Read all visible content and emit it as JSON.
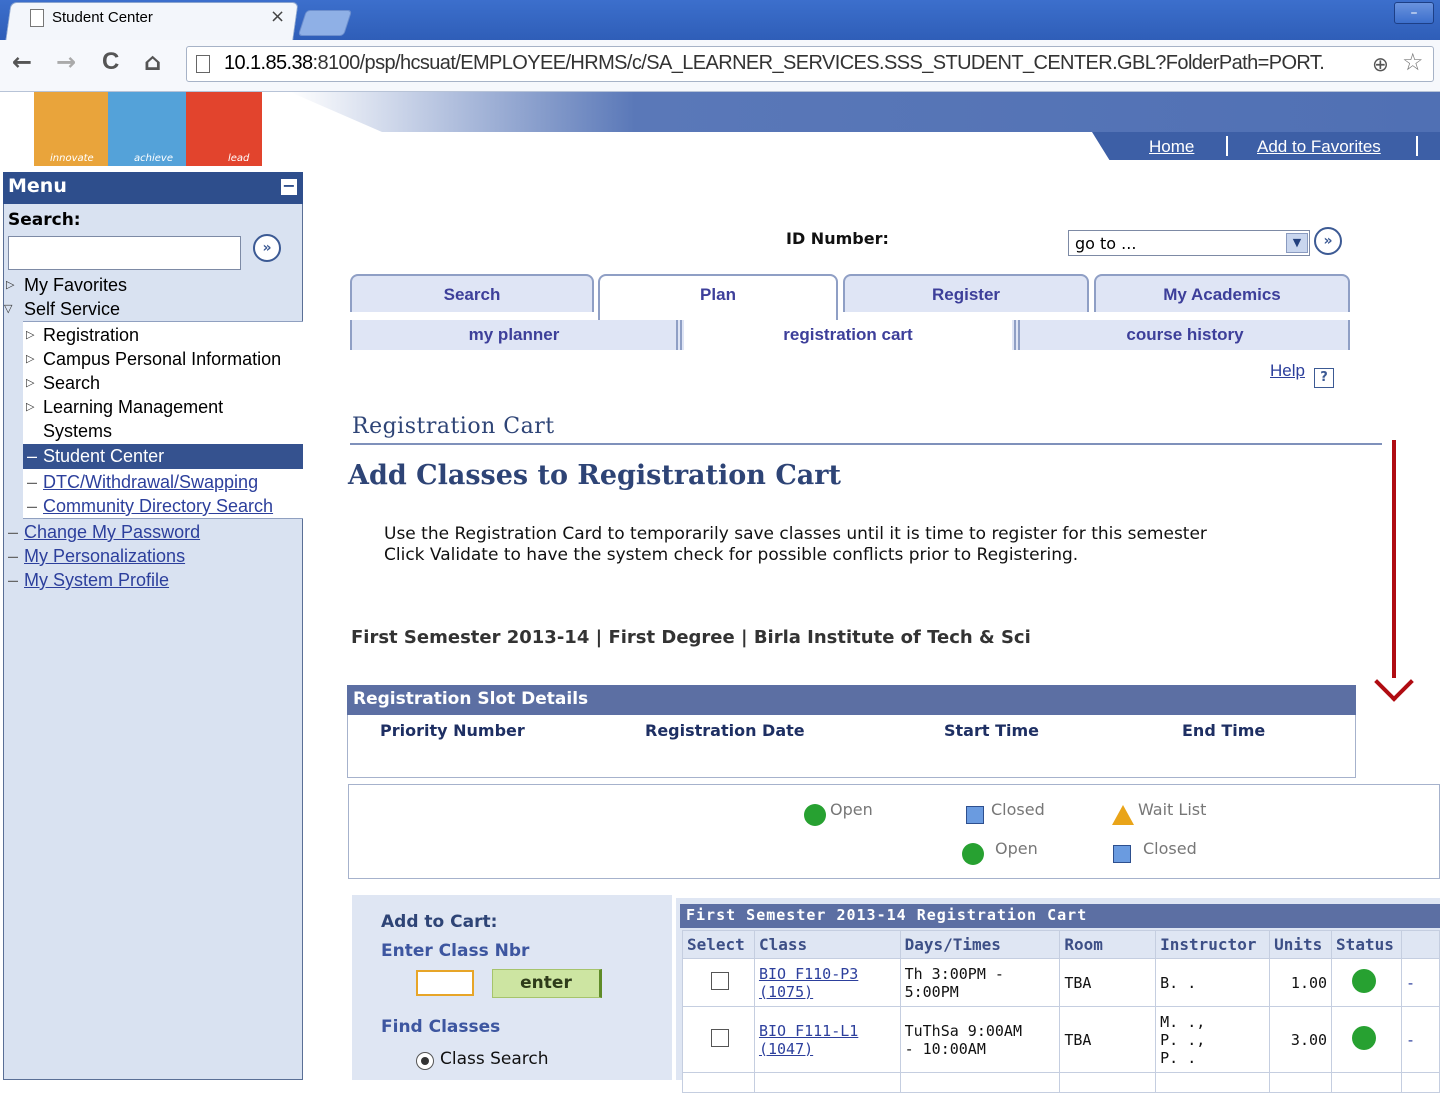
{
  "browser": {
    "tab_title": "Student Center",
    "tab_close": "×",
    "url_host": "10.1.85.38",
    "url_rest": ":8100/psp/hcsuat/EMPLOYEE/HRMS/c/SA_LEARNER_SERVICES.SSS_STUDENT_CENTER.GBL?FolderPath=PORT.",
    "back": "←",
    "forward": "→",
    "reload": "C",
    "home": "⌂",
    "zoom": "⊕",
    "star": "☆",
    "window_min": "–"
  },
  "logo": {
    "words": [
      "innovate",
      "achieve",
      "lead"
    ]
  },
  "header": {
    "home_link": "Home",
    "favorites_link": "Add to Favorites"
  },
  "menu": {
    "title": "Menu",
    "collapse": "−",
    "search_label": "Search:",
    "go": "»",
    "items": [
      {
        "label": "My Favorites"
      },
      {
        "label": "Self Service"
      },
      {
        "label": "Registration"
      },
      {
        "label": "Campus Personal Information"
      },
      {
        "label": "Search"
      },
      {
        "label": "Learning Management"
      },
      {
        "label": "Systems"
      },
      {
        "label": "Student Center"
      },
      {
        "label": "DTC/Withdrawal/Swapping"
      },
      {
        "label": "Community Directory Search"
      },
      {
        "label": "Change My Password"
      },
      {
        "label": "My Personalizations"
      },
      {
        "label": "My System Profile"
      }
    ]
  },
  "content": {
    "id_label": "ID Number:",
    "goto_value": "go to ...",
    "tabs": [
      {
        "label": "Search"
      },
      {
        "label": "Plan"
      },
      {
        "label": "Register"
      },
      {
        "label": "My Academics"
      }
    ],
    "subtabs": [
      {
        "label": "my planner"
      },
      {
        "label": "registration cart"
      },
      {
        "label": "course history"
      }
    ],
    "help": "Help",
    "help_icon": "?",
    "page_title": "Registration Cart",
    "subheading": "Add Classes to Registration Cart",
    "instructions": "Use the Registration Card to temporarily save classes until it is time to register for this semester  Click Validate to have the system check for possible conflicts prior to Registering.",
    "term_line": "First Semester 2013-14 | First Degree | Birla Institute of Tech & Sci"
  },
  "slot": {
    "title": "Registration Slot Details",
    "columns": [
      "Priority Number",
      "Registration Date",
      "Start Time",
      "End Time"
    ]
  },
  "legend": {
    "open": "Open",
    "closed": "Closed",
    "wait_list": "Wait List",
    "open2": "Open",
    "closed2": "Closed"
  },
  "add_cart": {
    "title": "Add to Cart:",
    "enter_label": "Enter Class Nbr",
    "enter_button": "enter",
    "find_label": "Find Classes",
    "radio_label": "Class Search"
  },
  "cart": {
    "title": "First Semester 2013-14 Registration Cart",
    "columns": [
      "Select",
      "Class",
      "Days/Times",
      "Room",
      "Instructor",
      "Units",
      "Status"
    ],
    "rows": [
      {
        "class_a": "BIO F110-P3",
        "class_b": "(1075)",
        "days_a": "Th 3:00PM -",
        "days_b": "5:00PM",
        "room": "TBA",
        "inst_a": "B. .",
        "inst_b": "",
        "inst_c": "",
        "units": "1.00",
        "dash": "-"
      },
      {
        "class_a": "BIO F111-L1",
        "class_b": "(1047)",
        "days_a": "TuThSa 9:00AM",
        "days_b": "- 10:00AM",
        "room": "TBA",
        "inst_a": "M. .,",
        "inst_b": "P. .,",
        "inst_c": "P. .",
        "units": "3.00",
        "dash": "-"
      }
    ]
  }
}
